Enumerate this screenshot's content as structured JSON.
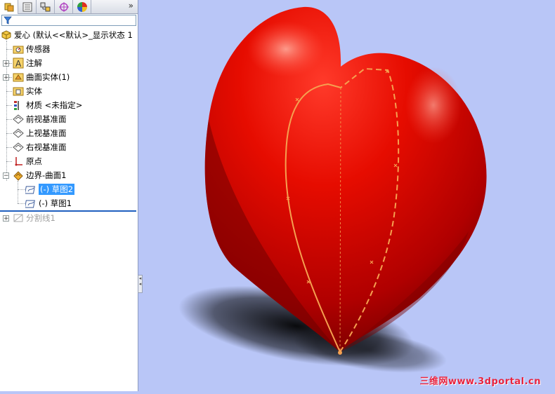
{
  "tabs": [
    {
      "name": "feature-manager",
      "active": true
    },
    {
      "name": "property-manager",
      "active": false
    },
    {
      "name": "configuration-manager",
      "active": false
    },
    {
      "name": "dimxpert-manager",
      "active": false
    },
    {
      "name": "display-manager",
      "active": false
    }
  ],
  "expand_glyph": "»",
  "tree": {
    "root": "爱心 (默认<<默认>_显示状态 1",
    "items": [
      {
        "label": "传感器"
      },
      {
        "label": "注解"
      },
      {
        "label": "曲面实体(1)"
      },
      {
        "label": "实体"
      },
      {
        "label": "材质 <未指定>"
      },
      {
        "label": "前视基准面"
      },
      {
        "label": "上视基准面"
      },
      {
        "label": "右视基准面"
      },
      {
        "label": "原点"
      },
      {
        "label": "边界-曲面1"
      },
      {
        "label": "(-) 草图2",
        "selected": true
      },
      {
        "label": "(-) 草图1"
      },
      {
        "label": "分割线1",
        "suppressed": true
      }
    ]
  },
  "colors": {
    "viewport_bg": "#b9c6f7",
    "heart": "#d60000",
    "sketch": "#f5a050",
    "selection": "#3399ff"
  },
  "watermark": "三维网www.3dportal.cn"
}
